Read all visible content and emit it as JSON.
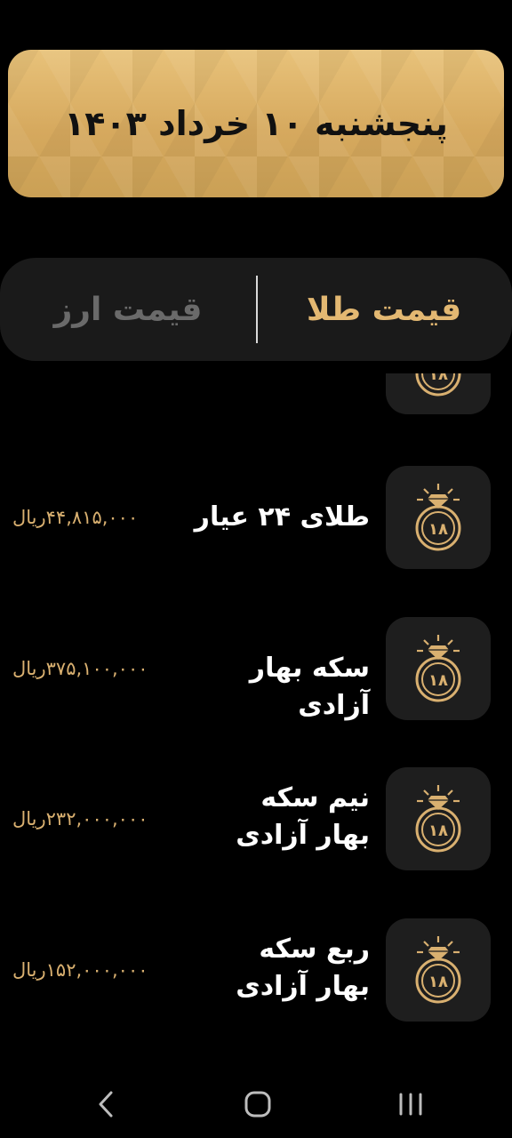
{
  "header": {
    "date": "پنجشنبه ۱۰ خرداد ۱۴۰۳"
  },
  "tabs": {
    "gold_label": "قیمت طلا",
    "currency_label": "قیمت ارز"
  },
  "items": [
    {
      "name": "",
      "price": "",
      "icon_label": "۱۸"
    },
    {
      "name": "طلای ۲۴ عیار",
      "price": "۴۴,۸۱۵,۰۰۰ریال",
      "icon_label": "۱۸"
    },
    {
      "name": "سکه بهار آزادی",
      "price": "۳۷۵,۱۰۰,۰۰۰ریال",
      "icon_label": "۱۸"
    },
    {
      "name": "نیم سکه بهار آزادی",
      "price": "۲۳۲,۰۰۰,۰۰۰ریال",
      "icon_label": "۱۸"
    },
    {
      "name": "ربع سکه بهار آزادی",
      "price": "۱۵۲,۰۰۰,۰۰۰ریال",
      "icon_label": "۱۸"
    }
  ],
  "icons": {
    "item_icon": "gold-ring-icon",
    "nav_back": "back-chevron-icon",
    "nav_home": "home-icon",
    "nav_recents": "recents-icon"
  },
  "colors": {
    "background": "#000000",
    "gold": "#e3b872",
    "banner": "#d6a95e",
    "card": "#1e1e1e",
    "tab_inactive": "#6a6a6a"
  }
}
